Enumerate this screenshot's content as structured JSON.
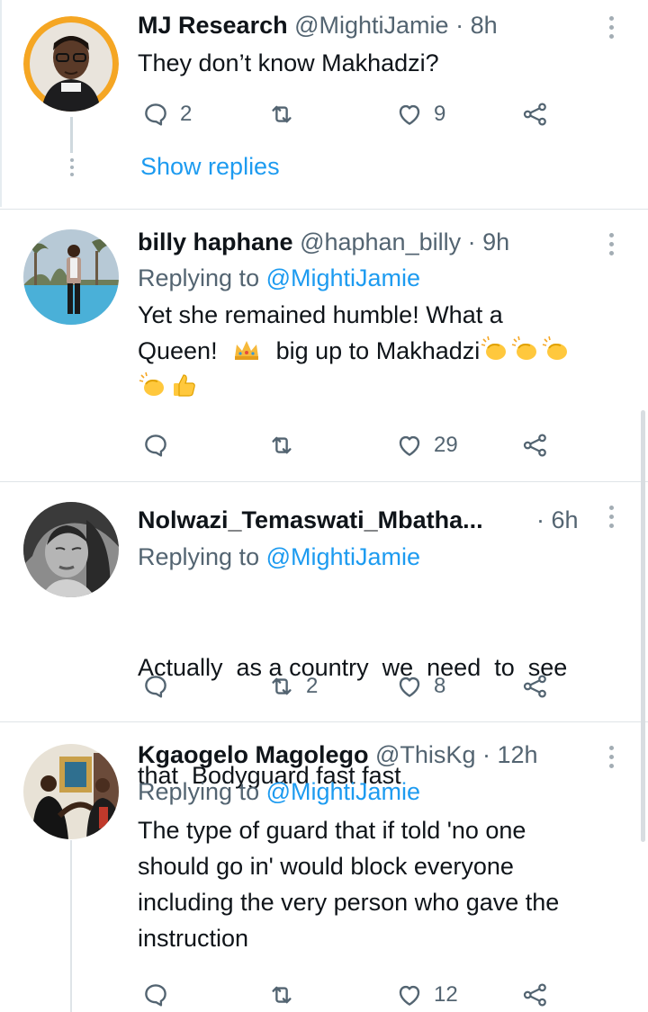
{
  "tweets": [
    {
      "name": "MJ Research",
      "handle": "@MightiJamie",
      "time": "· 8h",
      "replying_label": "",
      "replying_to": "",
      "lines": [
        "They don’t know Makhadzi?"
      ],
      "reply_count": "2",
      "retweet_count": "",
      "like_count": "9",
      "show_replies": "Show replies"
    },
    {
      "name": "billy haphane",
      "handle": "@haphan_billy",
      "time": "· 9h",
      "replying_label": "Replying to",
      "replying_to": "@MightiJamie",
      "lines": [
        "Yet she remained humble! What a",
        "Queen!",
        "big up to Makhadzi"
      ],
      "reply_count": "",
      "retweet_count": "",
      "like_count": "29"
    },
    {
      "name": "Nolwazi_Temaswati_Mbatha...",
      "handle": "",
      "time": "· 6h",
      "replying_label": "Replying to",
      "replying_to": "@MightiJamie",
      "lines": [
        "Actually  as a country  we  need  to  see",
        "that  Bodyguard fast fast"
      ],
      "reply_count": "",
      "retweet_count": "2",
      "like_count": "8"
    },
    {
      "name": "Kgaogelo Magolego",
      "handle": "@ThisKg",
      "time": "· 12h",
      "replying_label": "Replying to",
      "replying_to": "@MightiJamie",
      "lines": [
        "The type of guard that if told 'no one",
        "should go in' would block everyone",
        "including the very person who gave the",
        "instruction"
      ],
      "reply_count": "",
      "retweet_count": "",
      "like_count": "12"
    }
  ],
  "icons": {
    "reply": "reply-icon",
    "retweet": "retweet-icon",
    "like": "heart-icon",
    "share": "share-icon",
    "more": "more-vertical-icon",
    "crown": "crown-emoji",
    "clap": "clapping-hands-emoji",
    "thumbs": "thumbs-up-emoji"
  },
  "colors": {
    "link": "#1d9bf0",
    "secondary_text": "#536471",
    "thread_line": "#cfd9de",
    "divider": "#dfe4e8",
    "avatar_ring": "#f5a623"
  }
}
